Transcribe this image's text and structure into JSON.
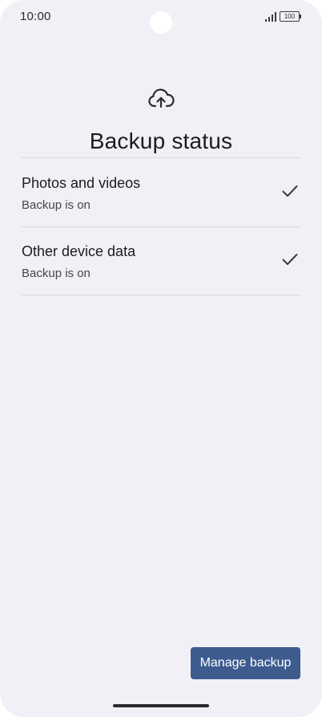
{
  "status_bar": {
    "time": "10:00",
    "battery_level": "100",
    "icons": [
      "signal-icon",
      "battery-icon"
    ]
  },
  "header": {
    "icon": "cloud-upload-icon",
    "title": "Backup status"
  },
  "items": [
    {
      "title": "Photos and videos",
      "subtitle": "Backup is on",
      "status_icon": "check-icon"
    },
    {
      "title": "Other device data",
      "subtitle": "Backup is on",
      "status_icon": "check-icon"
    }
  ],
  "actions": {
    "manage_label": "Manage backup"
  },
  "colors": {
    "background": "#f0f0f6",
    "accent_button": "#3e5b8e",
    "text_primary": "#1b1c20",
    "text_secondary": "#46474d",
    "divider": "#d9d9df"
  }
}
